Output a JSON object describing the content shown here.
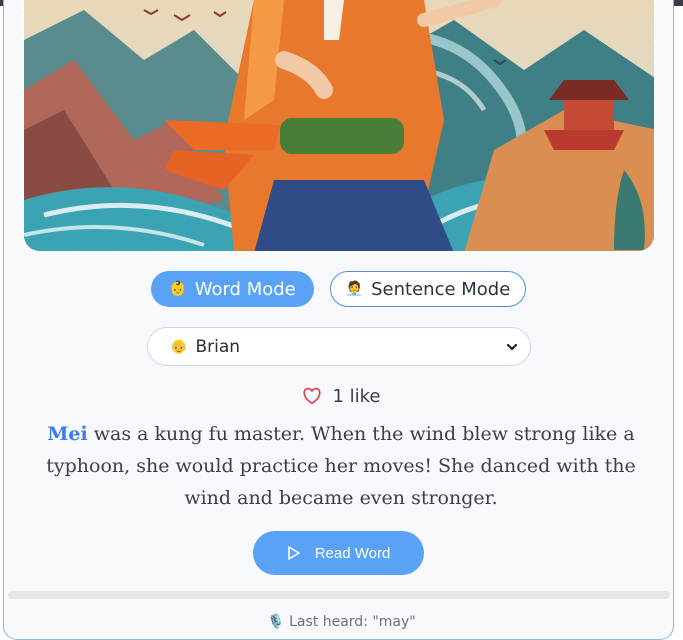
{
  "modes": {
    "word": {
      "label": "Word Mode",
      "emoji": "👶"
    },
    "sentence": {
      "label": "Sentence Mode",
      "emoji": "🧑‍💼"
    },
    "active": "word"
  },
  "voice_select": {
    "selected": "Brian",
    "emoji": "👴"
  },
  "likes": {
    "text": "1 like"
  },
  "story": {
    "highlighted_word": "Mei",
    "rest": " was a kung fu master. When the wind blew strong like a typhoon, she would practice her moves! She danced with the wind and became even stronger."
  },
  "read_button": {
    "label": "Read Word"
  },
  "status": {
    "last_heard": "🎙️ Last heard: \"may\""
  },
  "colors": {
    "accent": "#5aa2f5",
    "highlight": "#3b7ce8",
    "like": "#e0404a"
  }
}
